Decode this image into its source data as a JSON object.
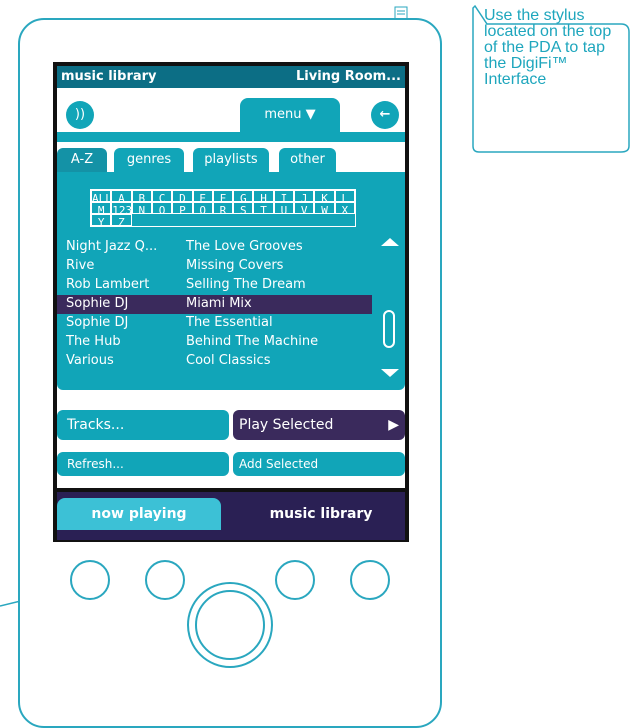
{
  "window": {
    "title": "music library",
    "zone": "Living Room..."
  },
  "toolbar": {
    "menu_label": "menu",
    "volume_icon": "volume-icon",
    "back_icon": "back-arrow-icon"
  },
  "tabs": [
    "A-Z",
    "genres",
    "playlists",
    "other"
  ],
  "alphabet": {
    "row1": [
      "ALL",
      "A",
      "B",
      "C",
      "D",
      "E",
      "F",
      "G",
      "H",
      "I",
      "J",
      "K",
      "L",
      "M"
    ],
    "row2": [
      "123",
      "N",
      "O",
      "P",
      "Q",
      "R",
      "S",
      "T",
      "U",
      "V",
      "W",
      "X",
      "Y",
      "Z"
    ]
  },
  "list": {
    "rows": [
      {
        "artist": "Night Jazz Q...",
        "album": "The Love Grooves",
        "selected": false
      },
      {
        "artist": "Rive",
        "album": "Missing Covers",
        "selected": false
      },
      {
        "artist": "Rob Lambert",
        "album": "Selling The Dream",
        "selected": false
      },
      {
        "artist": "Sophie DJ",
        "album": "Miami Mix",
        "selected": true
      },
      {
        "artist": "Sophie DJ",
        "album": "The Essential",
        "selected": false
      },
      {
        "artist": "The Hub",
        "album": "Behind The Machine",
        "selected": false
      },
      {
        "artist": "Various",
        "album": "Cool Classics",
        "selected": false
      }
    ]
  },
  "actions": {
    "tracks_label": "Tracks...",
    "play_selected_label": "Play Selected",
    "refresh_label": "Refresh...",
    "add_selected_label": "Add Selected"
  },
  "nav": {
    "now_playing": "now playing",
    "music_library": "music library"
  },
  "callout": {
    "text": "Use the stylus located on the top of the PDA to tap the DigiFi™ Interface"
  },
  "colors": {
    "teal": "#11a5b8",
    "dark_teal": "#0c6e85",
    "purple": "#3a2a5c",
    "outline": "#2aa7bf"
  }
}
